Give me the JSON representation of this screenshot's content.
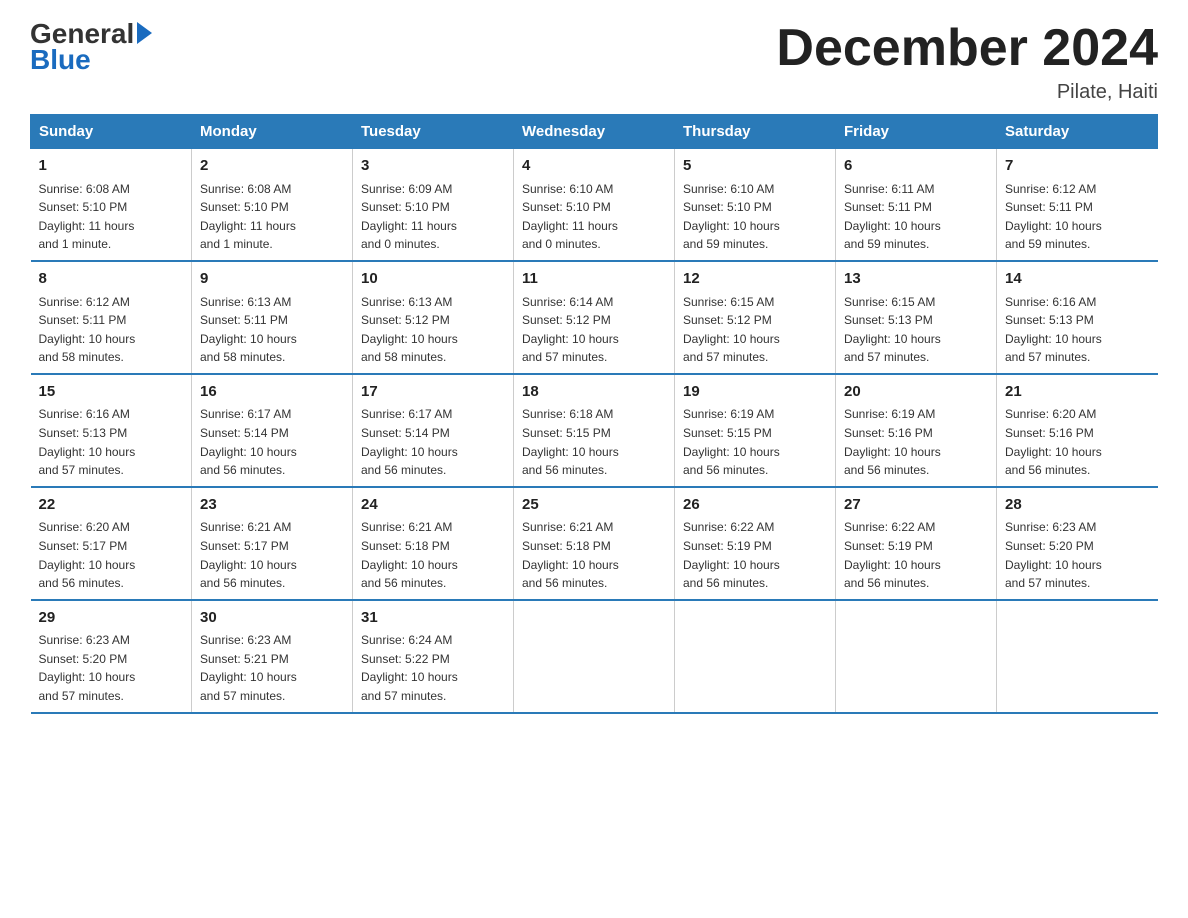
{
  "logo": {
    "general": "General",
    "blue": "Blue",
    "arrow": "▶"
  },
  "header": {
    "month": "December 2024",
    "location": "Pilate, Haiti"
  },
  "days_of_week": [
    "Sunday",
    "Monday",
    "Tuesday",
    "Wednesday",
    "Thursday",
    "Friday",
    "Saturday"
  ],
  "weeks": [
    [
      {
        "day": "1",
        "sunrise": "6:08 AM",
        "sunset": "5:10 PM",
        "daylight": "11 hours and 1 minute."
      },
      {
        "day": "2",
        "sunrise": "6:08 AM",
        "sunset": "5:10 PM",
        "daylight": "11 hours and 1 minute."
      },
      {
        "day": "3",
        "sunrise": "6:09 AM",
        "sunset": "5:10 PM",
        "daylight": "11 hours and 0 minutes."
      },
      {
        "day": "4",
        "sunrise": "6:10 AM",
        "sunset": "5:10 PM",
        "daylight": "11 hours and 0 minutes."
      },
      {
        "day": "5",
        "sunrise": "6:10 AM",
        "sunset": "5:10 PM",
        "daylight": "10 hours and 59 minutes."
      },
      {
        "day": "6",
        "sunrise": "6:11 AM",
        "sunset": "5:11 PM",
        "daylight": "10 hours and 59 minutes."
      },
      {
        "day": "7",
        "sunrise": "6:12 AM",
        "sunset": "5:11 PM",
        "daylight": "10 hours and 59 minutes."
      }
    ],
    [
      {
        "day": "8",
        "sunrise": "6:12 AM",
        "sunset": "5:11 PM",
        "daylight": "10 hours and 58 minutes."
      },
      {
        "day": "9",
        "sunrise": "6:13 AM",
        "sunset": "5:11 PM",
        "daylight": "10 hours and 58 minutes."
      },
      {
        "day": "10",
        "sunrise": "6:13 AM",
        "sunset": "5:12 PM",
        "daylight": "10 hours and 58 minutes."
      },
      {
        "day": "11",
        "sunrise": "6:14 AM",
        "sunset": "5:12 PM",
        "daylight": "10 hours and 57 minutes."
      },
      {
        "day": "12",
        "sunrise": "6:15 AM",
        "sunset": "5:12 PM",
        "daylight": "10 hours and 57 minutes."
      },
      {
        "day": "13",
        "sunrise": "6:15 AM",
        "sunset": "5:13 PM",
        "daylight": "10 hours and 57 minutes."
      },
      {
        "day": "14",
        "sunrise": "6:16 AM",
        "sunset": "5:13 PM",
        "daylight": "10 hours and 57 minutes."
      }
    ],
    [
      {
        "day": "15",
        "sunrise": "6:16 AM",
        "sunset": "5:13 PM",
        "daylight": "10 hours and 57 minutes."
      },
      {
        "day": "16",
        "sunrise": "6:17 AM",
        "sunset": "5:14 PM",
        "daylight": "10 hours and 56 minutes."
      },
      {
        "day": "17",
        "sunrise": "6:17 AM",
        "sunset": "5:14 PM",
        "daylight": "10 hours and 56 minutes."
      },
      {
        "day": "18",
        "sunrise": "6:18 AM",
        "sunset": "5:15 PM",
        "daylight": "10 hours and 56 minutes."
      },
      {
        "day": "19",
        "sunrise": "6:19 AM",
        "sunset": "5:15 PM",
        "daylight": "10 hours and 56 minutes."
      },
      {
        "day": "20",
        "sunrise": "6:19 AM",
        "sunset": "5:16 PM",
        "daylight": "10 hours and 56 minutes."
      },
      {
        "day": "21",
        "sunrise": "6:20 AM",
        "sunset": "5:16 PM",
        "daylight": "10 hours and 56 minutes."
      }
    ],
    [
      {
        "day": "22",
        "sunrise": "6:20 AM",
        "sunset": "5:17 PM",
        "daylight": "10 hours and 56 minutes."
      },
      {
        "day": "23",
        "sunrise": "6:21 AM",
        "sunset": "5:17 PM",
        "daylight": "10 hours and 56 minutes."
      },
      {
        "day": "24",
        "sunrise": "6:21 AM",
        "sunset": "5:18 PM",
        "daylight": "10 hours and 56 minutes."
      },
      {
        "day": "25",
        "sunrise": "6:21 AM",
        "sunset": "5:18 PM",
        "daylight": "10 hours and 56 minutes."
      },
      {
        "day": "26",
        "sunrise": "6:22 AM",
        "sunset": "5:19 PM",
        "daylight": "10 hours and 56 minutes."
      },
      {
        "day": "27",
        "sunrise": "6:22 AM",
        "sunset": "5:19 PM",
        "daylight": "10 hours and 56 minutes."
      },
      {
        "day": "28",
        "sunrise": "6:23 AM",
        "sunset": "5:20 PM",
        "daylight": "10 hours and 57 minutes."
      }
    ],
    [
      {
        "day": "29",
        "sunrise": "6:23 AM",
        "sunset": "5:20 PM",
        "daylight": "10 hours and 57 minutes."
      },
      {
        "day": "30",
        "sunrise": "6:23 AM",
        "sunset": "5:21 PM",
        "daylight": "10 hours and 57 minutes."
      },
      {
        "day": "31",
        "sunrise": "6:24 AM",
        "sunset": "5:22 PM",
        "daylight": "10 hours and 57 minutes."
      },
      null,
      null,
      null,
      null
    ]
  ],
  "labels": {
    "sunrise": "Sunrise:",
    "sunset": "Sunset:",
    "daylight": "Daylight:"
  }
}
